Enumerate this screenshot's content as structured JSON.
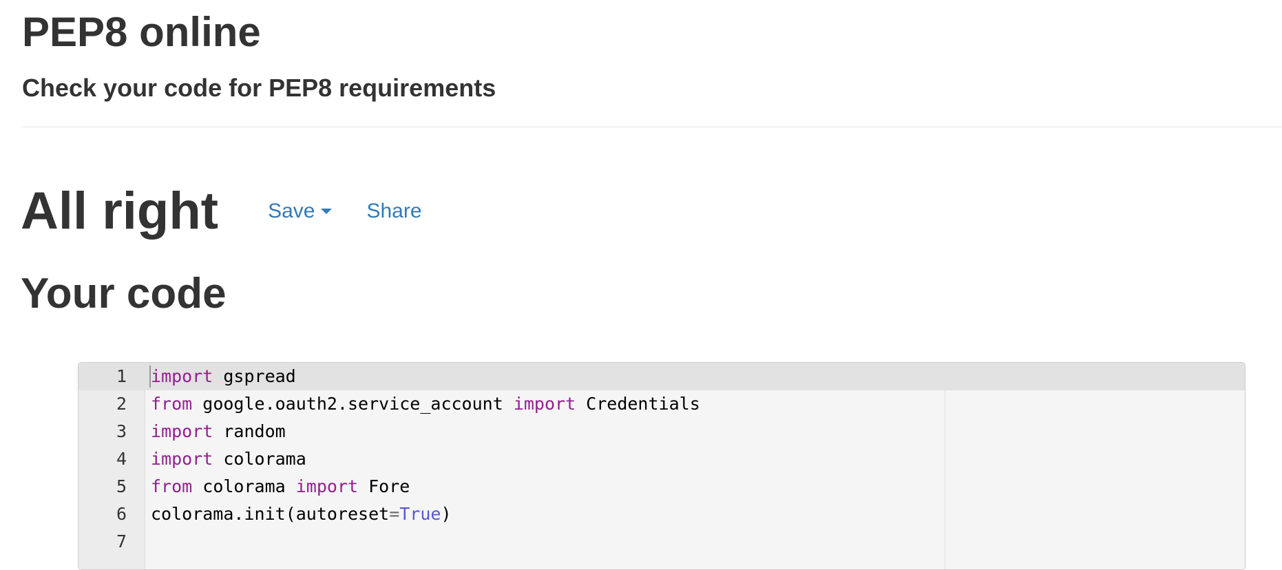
{
  "header": {
    "title": "PEP8 online",
    "subtitle": "Check your code for PEP8 requirements"
  },
  "result": {
    "status": "All right",
    "save_label": "Save",
    "share_label": "Share"
  },
  "code_section": {
    "heading": "Your code"
  },
  "editor": {
    "active_line": 1,
    "lines": [
      {
        "number": "1",
        "tokens": [
          {
            "t": "import",
            "k": "kw"
          },
          {
            "t": " gspread"
          }
        ]
      },
      {
        "number": "2",
        "tokens": [
          {
            "t": "from",
            "k": "kw"
          },
          {
            "t": " google.oauth2.service_account "
          },
          {
            "t": "import",
            "k": "kw"
          },
          {
            "t": " Credentials"
          }
        ]
      },
      {
        "number": "3",
        "tokens": [
          {
            "t": "import",
            "k": "kw"
          },
          {
            "t": " random"
          }
        ]
      },
      {
        "number": "4",
        "tokens": [
          {
            "t": "import",
            "k": "kw"
          },
          {
            "t": " colorama"
          }
        ]
      },
      {
        "number": "5",
        "tokens": [
          {
            "t": "from",
            "k": "kw"
          },
          {
            "t": " colorama "
          },
          {
            "t": "import",
            "k": "kw"
          },
          {
            "t": " Fore"
          }
        ]
      },
      {
        "number": "6",
        "tokens": [
          {
            "t": "colorama.init(autoreset"
          },
          {
            "t": "=",
            "k": "op"
          },
          {
            "t": "True",
            "k": "const"
          },
          {
            "t": ")"
          }
        ]
      },
      {
        "number": "7",
        "tokens": []
      }
    ]
  },
  "colors": {
    "link": "#337ab7",
    "keyword": "#931f8f",
    "constant": "#5856d6",
    "heading_text": "#333333"
  }
}
